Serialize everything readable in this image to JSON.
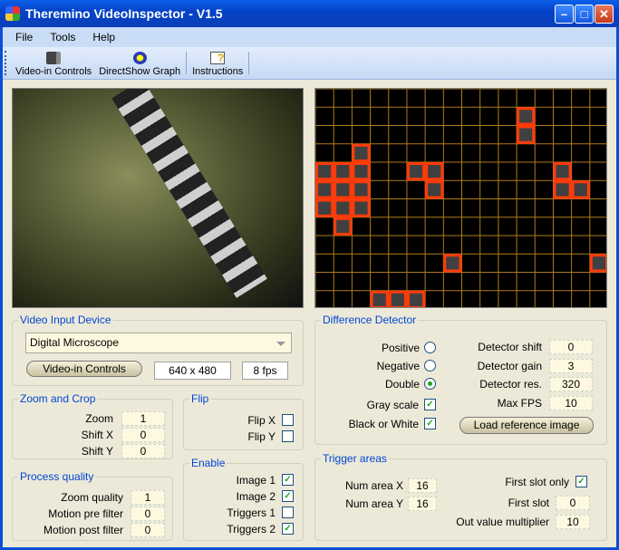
{
  "window": {
    "title": "Theremino VideoInspector - V1.5"
  },
  "menu": [
    "File",
    "Tools",
    "Help"
  ],
  "toolbar": [
    {
      "label": "Video-in Controls",
      "icon": "camera-icon"
    },
    {
      "label": "DirectShow Graph",
      "icon": "directshow-icon"
    },
    {
      "label": "Instructions",
      "icon": "help-document-icon"
    }
  ],
  "colors": {
    "grid_line": "#b07a1a",
    "trigger_cell": "#ff3a0a",
    "group_title": "#0046d5"
  },
  "trigger_grid": {
    "columns": 16,
    "rows": 12,
    "active_cells": [
      [
        2,
        3
      ],
      [
        0,
        4
      ],
      [
        1,
        4
      ],
      [
        2,
        4
      ],
      [
        0,
        5
      ],
      [
        1,
        5
      ],
      [
        2,
        5
      ],
      [
        0,
        6
      ],
      [
        1,
        6
      ],
      [
        2,
        6
      ],
      [
        1,
        7
      ],
      [
        5,
        4
      ],
      [
        6,
        4
      ],
      [
        6,
        5
      ],
      [
        11,
        1
      ],
      [
        11,
        2
      ],
      [
        13,
        4
      ],
      [
        13,
        5
      ],
      [
        14,
        5
      ],
      [
        7,
        9
      ],
      [
        15,
        9
      ],
      [
        3,
        11
      ],
      [
        4,
        11
      ],
      [
        5,
        11
      ]
    ]
  },
  "video_input": {
    "title": "Video Input Device",
    "device": "Digital Microscope",
    "controls_button": "Video-in Controls",
    "resolution": "640 x 480",
    "fps": "8 fps"
  },
  "zoom_crop": {
    "title": "Zoom and Crop",
    "fields": [
      {
        "label": "Zoom",
        "value": "1"
      },
      {
        "label": "Shift X",
        "value": "0"
      },
      {
        "label": "Shift Y",
        "value": "0"
      }
    ]
  },
  "flip": {
    "title": "Flip",
    "items": [
      {
        "label": "Flip X",
        "checked": false
      },
      {
        "label": "Flip Y",
        "checked": false
      }
    ]
  },
  "process": {
    "title": "Process quality",
    "fields": [
      {
        "label": "Zoom quality",
        "value": "1"
      },
      {
        "label": "Motion pre filter",
        "value": "0"
      },
      {
        "label": "Motion post filter",
        "value": "0"
      }
    ]
  },
  "enable": {
    "title": "Enable",
    "items": [
      {
        "label": "Image 1",
        "checked": true
      },
      {
        "label": "Image 2",
        "checked": true
      },
      {
        "label": "Triggers 1",
        "checked": false
      },
      {
        "label": "Triggers 2",
        "checked": true
      }
    ]
  },
  "detector": {
    "title": "Difference Detector",
    "modes": [
      {
        "label": "Positive",
        "selected": false
      },
      {
        "label": "Negative",
        "selected": false
      },
      {
        "label": "Double",
        "selected": true
      }
    ],
    "options": [
      {
        "label": "Gray scale",
        "checked": true
      },
      {
        "label": "Black or White",
        "checked": true
      }
    ],
    "fields": [
      {
        "label": "Detector shift",
        "value": "0"
      },
      {
        "label": "Detector gain",
        "value": "3"
      },
      {
        "label": "Detector res.",
        "value": "320"
      },
      {
        "label": "Max FPS",
        "value": "10"
      }
    ],
    "load_button": "Load reference image"
  },
  "trigger": {
    "title": "Trigger areas",
    "num_x_label": "Num area X",
    "num_x": "16",
    "num_y_label": "Num area Y",
    "num_y": "16",
    "first_slot_only_label": "First slot only",
    "first_slot_only": true,
    "first_slot_label": "First slot",
    "first_slot": "0",
    "multiplier_label": "Out value multiplier",
    "multiplier": "10"
  }
}
